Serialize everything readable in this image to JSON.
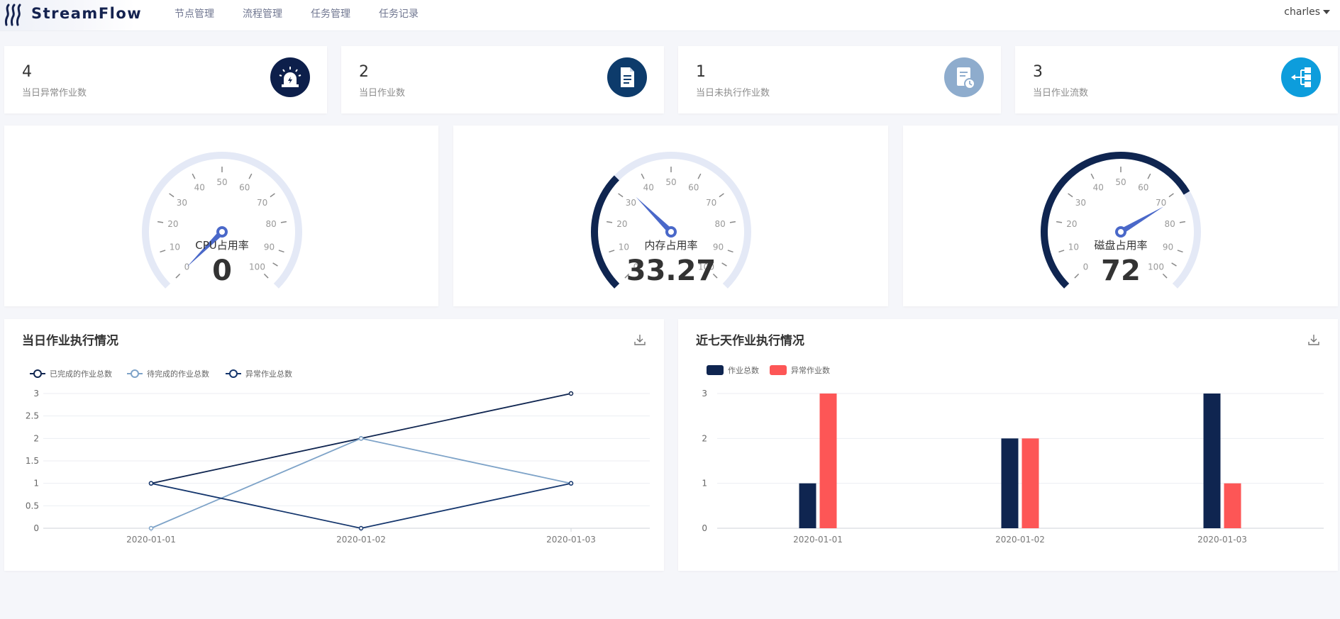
{
  "app": {
    "name": "StreamFlow"
  },
  "nav": [
    {
      "label": "节点管理"
    },
    {
      "label": "流程管理"
    },
    {
      "label": "任务管理"
    },
    {
      "label": "任务记录"
    }
  ],
  "user": {
    "name": "charles"
  },
  "stats": [
    {
      "value": "4",
      "label": "当日异常作业数",
      "icon": "alarm-icon",
      "color": "#0d1f4b"
    },
    {
      "value": "2",
      "label": "当日作业数",
      "icon": "document-icon",
      "color": "#0d3b6b"
    },
    {
      "value": "1",
      "label": "当日未执行作业数",
      "icon": "pending-document-icon",
      "color": "#8eaccd"
    },
    {
      "value": "3",
      "label": "当日作业流数",
      "icon": "workflow-icon",
      "color": "#0d9ddc"
    }
  ],
  "gauges": [
    {
      "name": "CPU占用率",
      "value": 0,
      "display": "0"
    },
    {
      "name": "内存占用率",
      "value": 33.27,
      "display": "33.27"
    },
    {
      "name": "磁盘占用率",
      "value": 72,
      "display": "72"
    }
  ],
  "gauge_ticks": [
    "0",
    "10",
    "20",
    "30",
    "40",
    "50",
    "60",
    "70",
    "80",
    "90",
    "100"
  ],
  "colors": {
    "navy": "#0f2550",
    "light_blue": "#7ea3c8",
    "red": "#fd5656",
    "gauge_track": "#e4e9f6",
    "gauge_pointer": "#4a68c9"
  },
  "panels": {
    "daily": {
      "title": "当日作业执行情况"
    },
    "weekly": {
      "title": "近七天作业执行情况"
    }
  },
  "chart_data": [
    {
      "type": "line",
      "title": "当日作业执行情况",
      "x": [
        "2020-01-01",
        "2020-01-02",
        "2020-01-03"
      ],
      "ylim": [
        0,
        3
      ],
      "yticks": [
        "0",
        "0.5",
        "1",
        "1.5",
        "2",
        "2.5",
        "3"
      ],
      "grid": true,
      "legend": "top-left",
      "series": [
        {
          "name": "已完成的作业总数",
          "values": [
            1,
            2,
            3
          ],
          "color": "#0f2550"
        },
        {
          "name": "待完成的作业总数",
          "values": [
            0,
            2,
            1
          ],
          "color": "#7ea3c8"
        },
        {
          "name": "异常作业总数",
          "values": [
            1,
            0,
            1
          ],
          "color": "#15366d"
        }
      ]
    },
    {
      "type": "bar",
      "title": "近七天作业执行情况",
      "categories": [
        "2020-01-01",
        "2020-01-02",
        "2020-01-03"
      ],
      "ylim": [
        0,
        3
      ],
      "yticks": [
        "0",
        "1",
        "2",
        "3"
      ],
      "grid": true,
      "legend": "top-left",
      "series": [
        {
          "name": "作业总数",
          "values": [
            1,
            2,
            3
          ],
          "color": "#0f2550"
        },
        {
          "name": "异常作业数",
          "values": [
            3,
            2,
            1
          ],
          "color": "#fd5656"
        }
      ]
    }
  ]
}
